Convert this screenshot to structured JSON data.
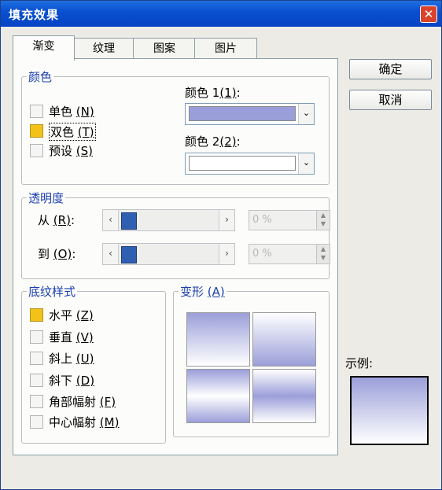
{
  "window": {
    "title": "填充效果",
    "close_symbol": "✕"
  },
  "tabs": [
    {
      "label": "渐变",
      "active": true
    },
    {
      "label": "纹理"
    },
    {
      "label": "图案"
    },
    {
      "label": "图片"
    }
  ],
  "colors_group": {
    "title": "颜色",
    "options": [
      {
        "label": "单色",
        "key": "(N)",
        "checked": false
      },
      {
        "label": "双色",
        "key": "(T)",
        "checked": true
      },
      {
        "label": "预设",
        "key": "(S)",
        "checked": false
      }
    ],
    "color1": {
      "label": "颜色 1",
      "key": "(1)",
      "suffix": ":",
      "value": "#9b9fd9"
    },
    "color2": {
      "label": "颜色 2",
      "key": "(2)",
      "suffix": ":",
      "value": "#ffffff"
    }
  },
  "transparency_group": {
    "title": "透明度",
    "from": {
      "label": "从",
      "key": "(R)",
      "suffix": ":",
      "value": "0 %",
      "level": 0
    },
    "to": {
      "label": "到",
      "key": "(O)",
      "suffix": ":",
      "value": "0 %",
      "level": 0
    }
  },
  "shading_group": {
    "title": "底纹样式",
    "options": [
      {
        "label": "水平",
        "key": "(Z)",
        "checked": true
      },
      {
        "label": "垂直",
        "key": "(V)",
        "checked": false
      },
      {
        "label": "斜上",
        "key": "(U)",
        "checked": false
      },
      {
        "label": "斜下",
        "key": "(D)",
        "checked": false
      },
      {
        "label": "角部幅射",
        "key": "(F)",
        "checked": false
      },
      {
        "label": "中心幅射",
        "key": "(M)",
        "checked": false
      }
    ]
  },
  "variants_group": {
    "title": "变形",
    "key": "(A)"
  },
  "buttons": {
    "ok": "确定",
    "cancel": "取消"
  },
  "sample": {
    "label": "示例:"
  },
  "icons": {
    "dropdown": "⌄",
    "left": "‹",
    "right": "›",
    "spin_up": "▲",
    "spin_down": "▼"
  }
}
